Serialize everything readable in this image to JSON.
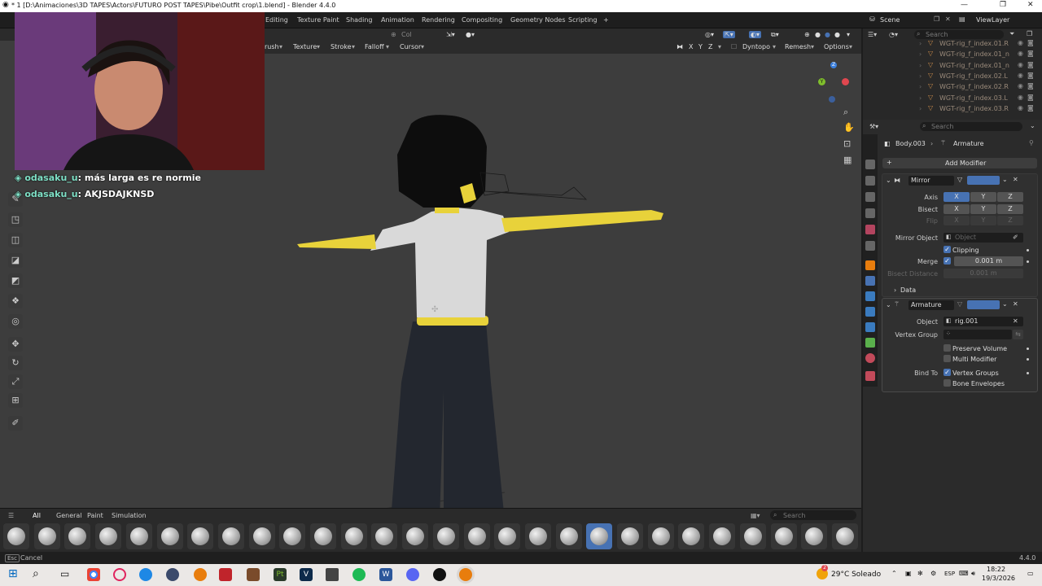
{
  "window": {
    "title": "* 1 [D:\\Animaciones\\3D TAPES\\Actors\\FUTURO POST TAPES\\Pibe\\Outfit crop\\1.blend] - Blender 4.4.0",
    "minimize": "—",
    "restore": "❐",
    "close": "✕"
  },
  "workspaces": [
    "Editing",
    "Texture Paint",
    "Shading",
    "Animation",
    "Rendering",
    "Compositing",
    "Geometry Nodes",
    "Scripting"
  ],
  "workspace_add": "+",
  "scene": {
    "label": "Scene",
    "view_layer": "ViewLayer"
  },
  "header": {
    "col": "Col",
    "brush": "rush",
    "texture": "Texture",
    "stroke": "Stroke",
    "falloff": "Falloff",
    "cursor": "Cursor",
    "x": "X",
    "y": "Y",
    "z": "Z",
    "dyntopo": "Dyntopo",
    "remesh": "Remesh",
    "options": "Options"
  },
  "chat": [
    {
      "user": "odasaku_u",
      "text": "más larga es re normie"
    },
    {
      "user": "odasaku_u",
      "text": "AKJSDAJKNSD"
    }
  ],
  "gizmo": {
    "x": "X",
    "y": "Y",
    "z": "Z"
  },
  "outliner": {
    "search_placeholder": "Search",
    "rows": [
      "WGT-rig_f_index.01.R",
      "WGT-rig_f_index.01_n",
      "WGT-rig_f_index.01_n",
      "WGT-rig_f_index.02.L",
      "WGT-rig_f_index.02.R",
      "WGT-rig_f_index.03.L",
      "WGT-rig_f_index.03.R"
    ]
  },
  "properties": {
    "search_placeholder": "Search",
    "object": "Body.003",
    "modifier_context": "Armature",
    "add_modifier": "Add Modifier",
    "mirror": {
      "name": "Mirror",
      "axis_label": "Axis",
      "bisect_label": "Bisect",
      "flip_label": "Flip",
      "x": "X",
      "y": "Y",
      "z": "Z",
      "mirror_object_label": "Mirror Object",
      "mirror_object_placeholder": "Object",
      "clipping": "Clipping",
      "merge_label": "Merge",
      "merge_value": "0.001 m",
      "bisect_distance_label": "Bisect Distance",
      "bisect_distance_value": "0.001 m",
      "data": "Data"
    },
    "armature": {
      "name": "Armature",
      "object_label": "Object",
      "object_value": "rig.001",
      "vertex_group_label": "Vertex Group",
      "preserve_volume": "Preserve Volume",
      "multi_modifier": "Multi Modifier",
      "bind_to_label": "Bind To",
      "vertex_groups": "Vertex Groups",
      "bone_envelopes": "Bone Envelopes"
    }
  },
  "brush_bar": {
    "categories": [
      "All",
      "General",
      "Paint",
      "Simulation"
    ],
    "search_placeholder": "Search"
  },
  "status": {
    "left": "Cancel",
    "esc": "Esc",
    "version": "4.4.0"
  },
  "taskbar": {
    "weather": "29°C  Soleado",
    "lang": "ESP",
    "time": "18:22",
    "date": "19/3/2026",
    "badge": "2"
  },
  "colors": {
    "accent": "#4772b3",
    "axis_x": "#e0474f",
    "axis_y": "#7fbe2c",
    "axis_z": "#3b7fdc",
    "skin": "#e8d23a"
  }
}
